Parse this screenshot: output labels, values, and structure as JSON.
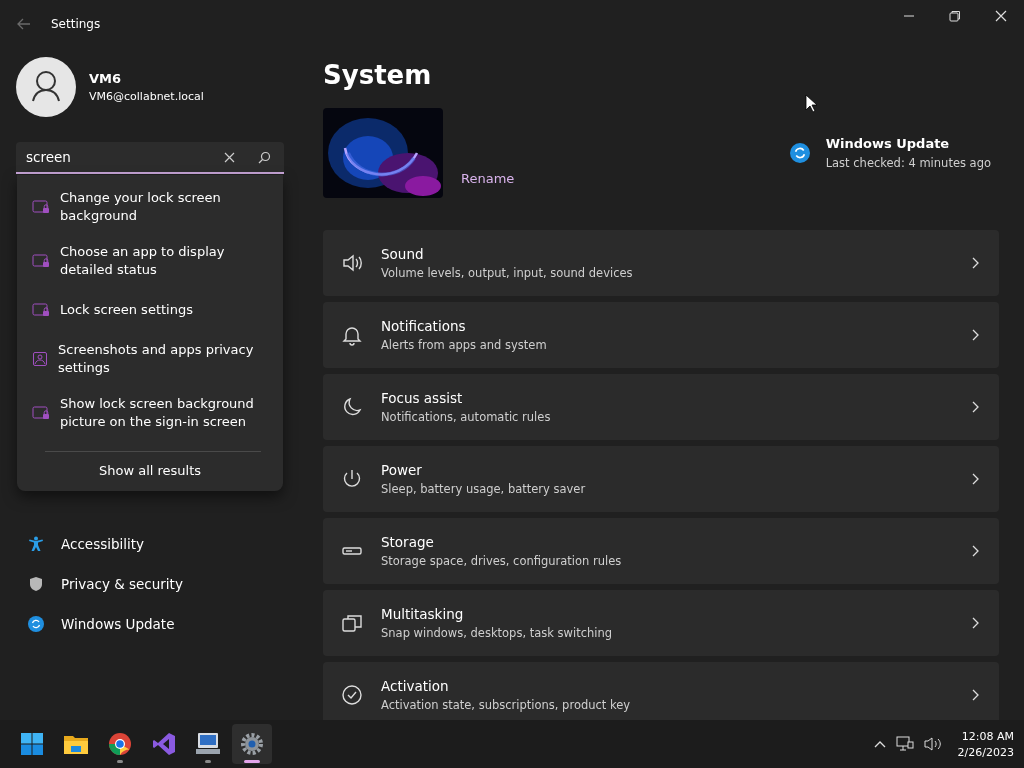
{
  "window": {
    "title": "Settings"
  },
  "account": {
    "name": "VM6",
    "email": "VM6@collabnet.local"
  },
  "search": {
    "value": "screen"
  },
  "search_results": [
    {
      "text": "Change your lock screen background"
    },
    {
      "text": "Choose an app to display detailed status"
    },
    {
      "text": "Lock screen settings"
    },
    {
      "text": "Screenshots and apps privacy settings"
    },
    {
      "text": "Show lock screen background picture on the sign-in screen"
    }
  ],
  "show_all": "Show all results",
  "sidebar": {
    "items": [
      {
        "label": "Accessibility",
        "selected": false
      },
      {
        "label": "Privacy & security",
        "selected": false
      },
      {
        "label": "Windows Update",
        "selected": false
      }
    ]
  },
  "page": {
    "title": "System",
    "rename": "Rename",
    "update": {
      "title": "Windows Update",
      "subtitle": "Last checked: 4 minutes ago"
    }
  },
  "cards": [
    {
      "title": "Sound",
      "subtitle": "Volume levels, output, input, sound devices"
    },
    {
      "title": "Notifications",
      "subtitle": "Alerts from apps and system"
    },
    {
      "title": "Focus assist",
      "subtitle": "Notifications, automatic rules"
    },
    {
      "title": "Power",
      "subtitle": "Sleep, battery usage, battery saver"
    },
    {
      "title": "Storage",
      "subtitle": "Storage space, drives, configuration rules"
    },
    {
      "title": "Multitasking",
      "subtitle": "Snap windows, desktops, task switching"
    },
    {
      "title": "Activation",
      "subtitle": "Activation state, subscriptions, product key"
    }
  ],
  "taskbar": {
    "apps": [
      {
        "running": false,
        "selected": false
      },
      {
        "running": false,
        "selected": false
      },
      {
        "running": true,
        "selected": false
      },
      {
        "running": false,
        "selected": false
      },
      {
        "running": true,
        "selected": false
      },
      {
        "running": true,
        "selected": true
      }
    ],
    "time": "12:08 AM",
    "date": "2/26/2023"
  }
}
